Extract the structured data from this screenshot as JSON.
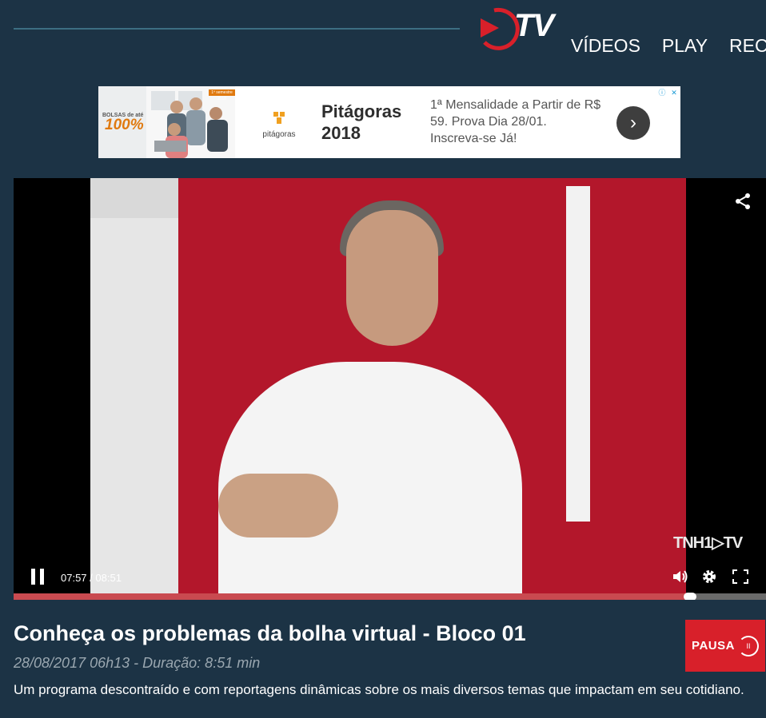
{
  "header": {
    "logo_text": "TV",
    "nav": [
      "VÍDEOS",
      "PLAY",
      "REC"
    ],
    "accent_color": "#d8202a"
  },
  "ad": {
    "photo_badge_tag": "BOLSAS de até",
    "photo_badge_value": "100%",
    "photo_top_strip": "1º semestre 2018",
    "logo_name": "pitágoras",
    "title_line1": "Pitágoras",
    "title_line2": "2018",
    "text": "1ª Mensalidade a Partir de R$ 59. Prova Dia 28/01. Inscreva-se Já!",
    "arrow": "›",
    "choices": [
      "ⓘ",
      "✕"
    ]
  },
  "player": {
    "watermark": "TNH1▷TV",
    "current_time": "07:57",
    "duration": "08:51",
    "time_separator": " / ",
    "progress": 0.899,
    "state": "playing"
  },
  "video": {
    "title": "Conheça os problemas da bolha virtual - Bloco 01",
    "meta": "28/08/2017 06h13 - Duração: 8:51 min",
    "description": "Um programa descontraído e com reportagens dinâmicas sobre os mais diversos temas que impactam em seu cotidiano."
  },
  "program_badge": {
    "label": "PAUSA",
    "icon": "II"
  }
}
